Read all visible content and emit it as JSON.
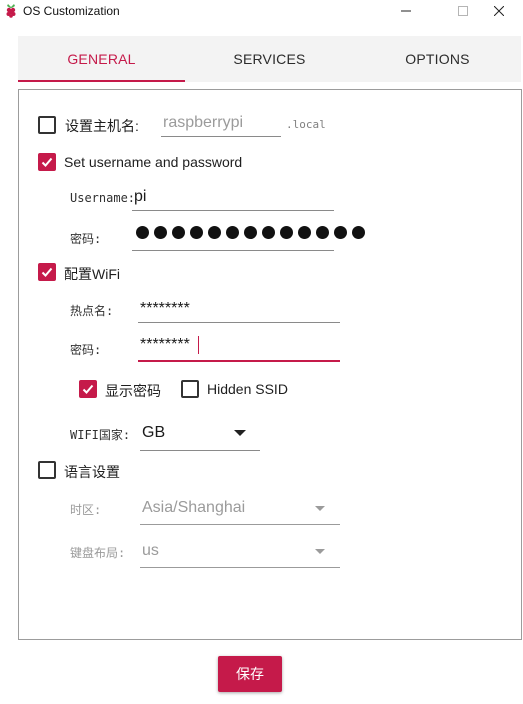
{
  "window": {
    "title": "OS Customization"
  },
  "tabs": [
    {
      "label": "GENERAL",
      "active": true
    },
    {
      "label": "SERVICES",
      "active": false
    },
    {
      "label": "OPTIONS",
      "active": false
    }
  ],
  "general": {
    "hostname": {
      "checked": false,
      "label": "设置主机名:",
      "value": "raspberrypi",
      "suffix": ".local"
    },
    "user": {
      "checked": true,
      "label": "Set username and password",
      "username_label": "Username:",
      "username_value": "pi",
      "password_label": "密码:",
      "password_mask_count": 13
    },
    "wifi": {
      "checked": true,
      "label": "配置WiFi",
      "ssid_label": "热点名:",
      "ssid_value": "********",
      "password_label": "密码:",
      "password_value": "********",
      "show_password": {
        "checked": true,
        "label": "显示密码"
      },
      "hidden_ssid": {
        "checked": false,
        "label": "Hidden SSID"
      },
      "country_label": "WIFI国家:",
      "country_value": "GB"
    },
    "locale": {
      "checked": false,
      "label": "语言设置",
      "timezone_label": "时区:",
      "timezone_value": "Asia/Shanghai",
      "keyboard_label": "键盘布局:",
      "keyboard_value": "us"
    }
  },
  "save_button": {
    "label": "保存"
  },
  "colors": {
    "accent": "#c51a4a",
    "tab_bg": "#f3f3f3",
    "border": "#9c9c9c"
  }
}
